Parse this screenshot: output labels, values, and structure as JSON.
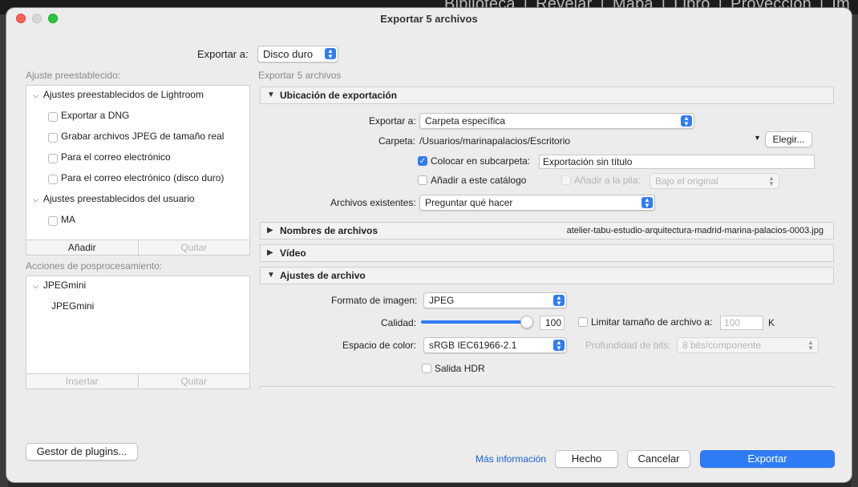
{
  "background": {
    "modules": [
      "Biblioteca",
      "Revelar",
      "Mapa",
      "Libro",
      "Proyección",
      "Im"
    ]
  },
  "dialog": {
    "title": "Exportar 5 archivos",
    "export_to_label": "Exportar a:",
    "export_to_value": "Disco duro"
  },
  "presets": {
    "header": "Ajuste preestablecido:",
    "groups": [
      {
        "label": "Ajustes preestablecidos de Lightroom",
        "items": [
          "Exportar a DNG",
          "Grabar archivos JPEG de tamaño real",
          "Para el correo electrónico",
          "Para el correo electrónico (disco duro)"
        ]
      },
      {
        "label": "Ajustes preestablecidos del usuario",
        "items": [
          "MA"
        ]
      }
    ],
    "add_label": "Añadir",
    "remove_label": "Quitar"
  },
  "postprocess": {
    "header": "Acciones de posprocesamiento:",
    "group": "JPEGmini",
    "item": "JPEGmini",
    "insert_label": "Insertar",
    "remove_label": "Quitar"
  },
  "right_header": "Exportar 5 archivos",
  "location": {
    "title": "Ubicación de exportación",
    "export_to_label": "Exportar a:",
    "export_to_value": "Carpeta específica",
    "folder_label": "Carpeta:",
    "folder_path": "/Usuarios/marinapalacios/Escritorio",
    "choose_label": "Elegir...",
    "subfolder_label": "Colocar en subcarpeta:",
    "subfolder_checked": true,
    "subfolder_value": "Exportación sin título",
    "catalog_label": "Añadir a este catálogo",
    "stack_label": "Añadir a la pila:",
    "stack_value": "Bajo el original",
    "existing_label": "Archivos existentes:",
    "existing_value": "Preguntar qué hacer"
  },
  "filenames": {
    "title": "Nombres de archivos",
    "summary": "atelier-tabu-estudio-arquitectura-madrid-marina-palacios-0003.jpg"
  },
  "video": {
    "title": "Vídeo"
  },
  "file_settings": {
    "title": "Ajustes de archivo",
    "format_label": "Formato de imagen:",
    "format_value": "JPEG",
    "quality_label": "Calidad:",
    "quality_value": "100",
    "quality_fraction": 1.0,
    "limit_label": "Limitar tamaño de archivo a:",
    "limit_value": "100",
    "limit_unit": "K",
    "colorspace_label": "Espacio de color:",
    "colorspace_value": "sRGB IEC61966-2.1",
    "bitdepth_label": "Profundidad de bits:",
    "bitdepth_value": "8 bits/componente",
    "hdr_label": "Salida HDR"
  },
  "footer": {
    "plugin_manager": "Gestor de plugins...",
    "more_info": "Más información",
    "done": "Hecho",
    "cancel": "Cancelar",
    "export": "Exportar"
  },
  "colors": {
    "accent": "#2f7cf6",
    "link": "#1a5fd6"
  }
}
